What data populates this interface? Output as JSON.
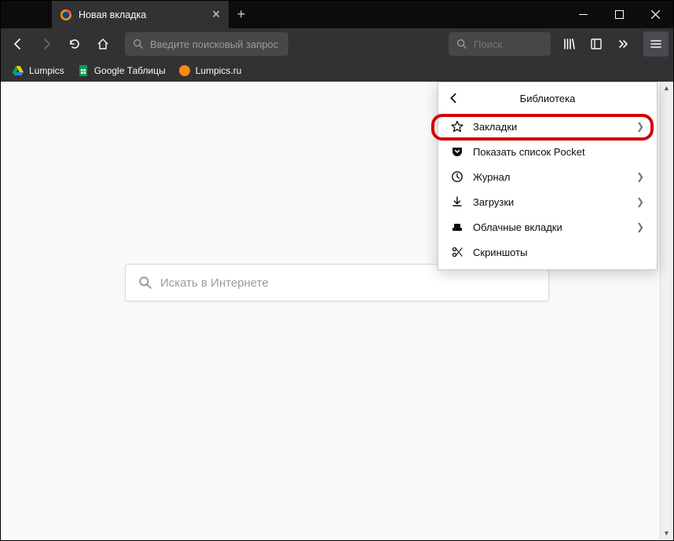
{
  "tab": {
    "title": "Новая вкладка"
  },
  "urlbar": {
    "placeholder": "Введите поисковый запрос или адрес"
  },
  "searchbar": {
    "placeholder": "Поиск"
  },
  "bookmarks_bar": [
    {
      "label": "Lumpics",
      "icon": "drive"
    },
    {
      "label": "Google Таблицы",
      "icon": "sheets"
    },
    {
      "label": "Lumpics.ru",
      "icon": "orange"
    }
  ],
  "content_search": {
    "placeholder": "Искать в Интернете"
  },
  "library_panel": {
    "title": "Библиотека",
    "items": [
      {
        "label": "Закладки",
        "icon": "star",
        "has_submenu": true,
        "highlighted": true
      },
      {
        "label": "Показать список Pocket",
        "icon": "pocket",
        "has_submenu": false
      },
      {
        "label": "Журнал",
        "icon": "history",
        "has_submenu": true
      },
      {
        "label": "Загрузки",
        "icon": "downloads",
        "has_submenu": true
      },
      {
        "label": "Облачные вкладки",
        "icon": "synced",
        "has_submenu": true
      },
      {
        "label": "Скриншоты",
        "icon": "screenshot",
        "has_submenu": false
      }
    ]
  }
}
